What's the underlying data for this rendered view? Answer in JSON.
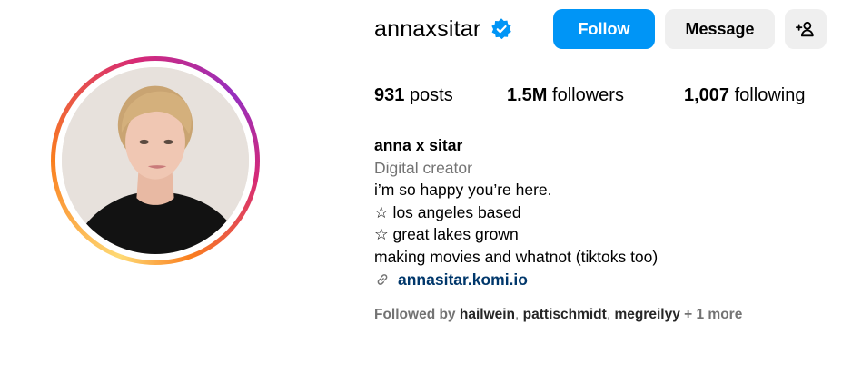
{
  "profile": {
    "username": "annaxsitar",
    "verified_icon": "verified-badge-icon",
    "avatar_icon": "profile-photo"
  },
  "actions": {
    "follow_label": "Follow",
    "message_label": "Message",
    "suggest_icon": "add-person-icon"
  },
  "stats": {
    "posts_count": "931",
    "posts_label": "posts",
    "followers_count": "1.5M",
    "followers_label": "followers",
    "following_count": "1,007",
    "following_label": "following"
  },
  "bio": {
    "full_name": "anna x sitar",
    "category": "Digital creator",
    "lines": [
      "i’m so happy you’re here.",
      "☆ los angeles based",
      "☆ great lakes grown",
      "making movies and whatnot (tiktoks too)"
    ],
    "link_icon": "link-icon",
    "link_text": "annasitar.komi.io"
  },
  "followed_by": {
    "prefix": "Followed by",
    "users": [
      "hailwein",
      "pattischmidt",
      "megreilyy"
    ],
    "more": "+ 1 more"
  },
  "colors": {
    "primary_button": "#0095f6",
    "secondary_button": "#efefef",
    "muted_text": "#737373",
    "link": "#00376b",
    "verified": "#0095f6"
  }
}
